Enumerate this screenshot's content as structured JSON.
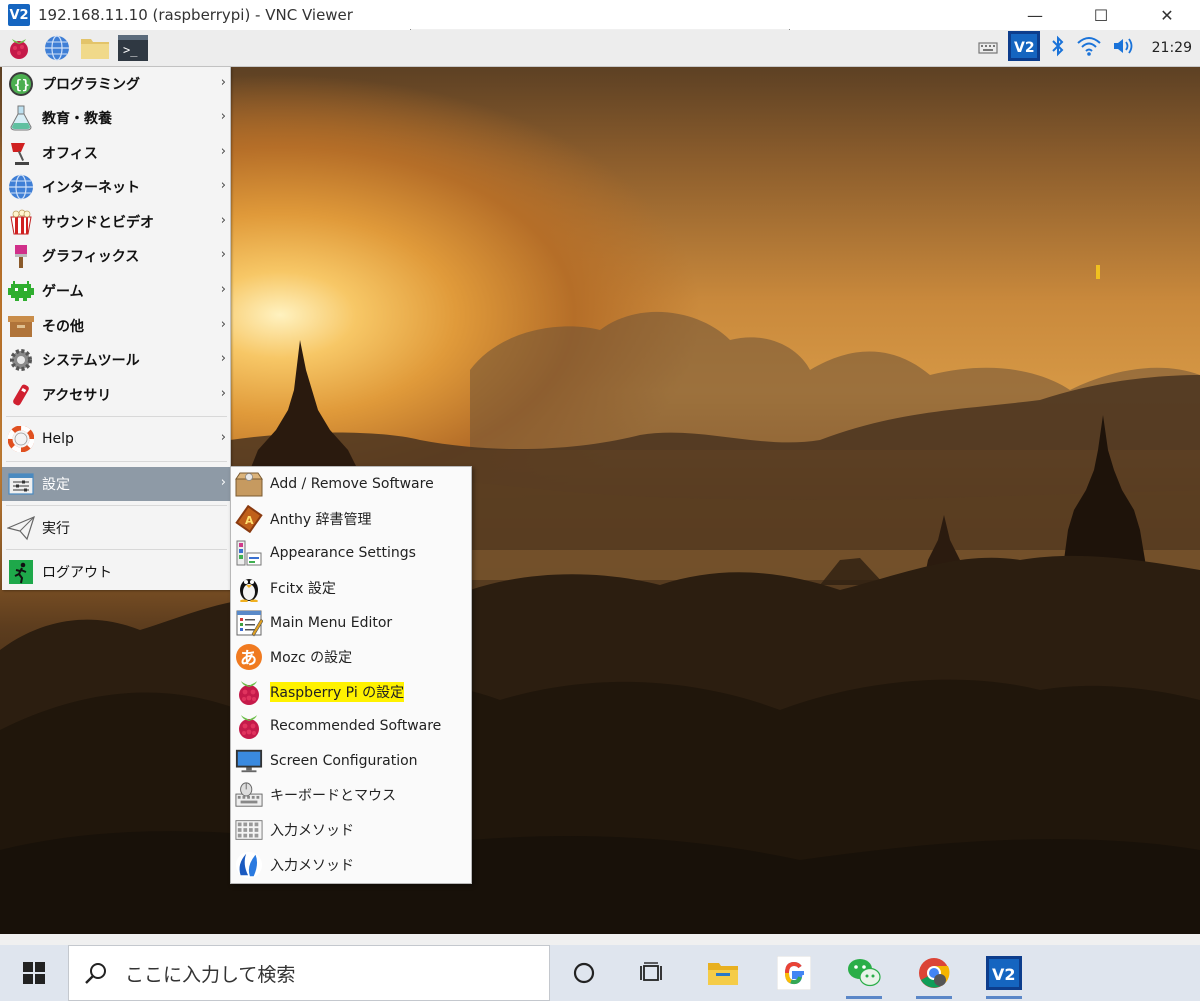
{
  "window": {
    "title": "192.168.11.10 (raspberrypi) - VNC Viewer",
    "logo_text": "V2",
    "minimize": "—",
    "maximize": "☐",
    "close": "✕"
  },
  "pi_panel": {
    "clock": "21:29",
    "left_icons": [
      "raspberry-menu-icon",
      "web-browser-icon",
      "file-manager-icon",
      "terminal-icon"
    ],
    "right_icons": [
      "keyboard-icon",
      "vnc-icon",
      "bluetooth-icon",
      "wifi-icon",
      "volume-icon"
    ]
  },
  "main_menu": {
    "items": [
      {
        "label": "プログラミング",
        "icon": "programming-icon",
        "has_submenu": true
      },
      {
        "label": "教育・教養",
        "icon": "education-icon",
        "has_submenu": true
      },
      {
        "label": "オフィス",
        "icon": "office-icon",
        "has_submenu": true
      },
      {
        "label": "インターネット",
        "icon": "internet-icon",
        "has_submenu": true
      },
      {
        "label": "サウンドとビデオ",
        "icon": "sound-video-icon",
        "has_submenu": true
      },
      {
        "label": "グラフィックス",
        "icon": "graphics-icon",
        "has_submenu": true
      },
      {
        "label": "ゲーム",
        "icon": "games-icon",
        "has_submenu": true
      },
      {
        "label": "その他",
        "icon": "other-icon",
        "has_submenu": true
      },
      {
        "label": "システムツール",
        "icon": "system-tools-icon",
        "has_submenu": true
      },
      {
        "label": "アクセサリ",
        "icon": "accessories-icon",
        "has_submenu": true
      },
      {
        "label": "Help",
        "icon": "help-icon",
        "has_submenu": true
      },
      {
        "label": "設定",
        "icon": "preferences-icon",
        "has_submenu": true,
        "selected": true
      },
      {
        "label": "実行",
        "icon": "run-icon",
        "has_submenu": false
      },
      {
        "label": "ログアウト",
        "icon": "logout-icon",
        "has_submenu": false
      }
    ],
    "arrow": "›"
  },
  "sub_menu": {
    "items": [
      {
        "label": "Add / Remove Software",
        "icon": "package-icon"
      },
      {
        "label": "Anthy 辞書管理",
        "icon": "dictionary-icon"
      },
      {
        "label": "Appearance Settings",
        "icon": "appearance-icon"
      },
      {
        "label": "Fcitx 設定",
        "icon": "penguin-icon"
      },
      {
        "label": "Main Menu Editor",
        "icon": "menu-editor-icon"
      },
      {
        "label": "Mozc の設定",
        "icon": "mozc-icon"
      },
      {
        "label": "Raspberry Pi の設定",
        "icon": "raspberry-icon",
        "highlighted": true
      },
      {
        "label": "Recommended Software",
        "icon": "raspberry-icon"
      },
      {
        "label": "Screen Configuration",
        "icon": "monitor-icon"
      },
      {
        "label": "キーボードとマウス",
        "icon": "keyboard-mouse-icon"
      },
      {
        "label": "入力メソッド",
        "icon": "keyboard-grid-icon"
      },
      {
        "label": "入力メソッド",
        "icon": "ibus-icon"
      }
    ]
  },
  "taskbar": {
    "search_placeholder": "ここに入力して検索",
    "icons": [
      "windows-start-icon",
      "cortana-icon",
      "task-view-icon",
      "file-explorer-icon",
      "google-icon",
      "wechat-icon",
      "chrome-icon",
      "vnc-viewer-icon"
    ]
  },
  "colors": {
    "menu_selected": "#8e9aa6",
    "highlight": "#fff200",
    "vnc_blue": "#1565c0"
  }
}
